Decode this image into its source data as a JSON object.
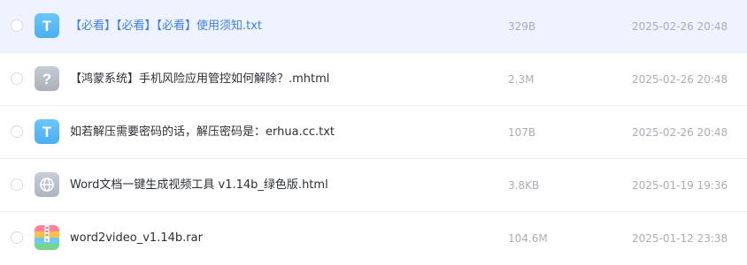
{
  "files": [
    {
      "name": "【必看】【必看】【必看】使用须知.txt",
      "size": "329B",
      "date": "2025-02-26 20:48",
      "icon": "text-file-icon",
      "selected": true
    },
    {
      "name": "【鸿蒙系统】手机风险应用管控如何解除？.mhtml",
      "size": "2.3M",
      "date": "2025-02-26 20:48",
      "icon": "unknown-file-icon",
      "selected": false
    },
    {
      "name": "如若解压需要密码的话，解压密码是：erhua.cc.txt",
      "size": "107B",
      "date": "2025-02-26 20:48",
      "icon": "text-file-icon",
      "selected": false
    },
    {
      "name": "Word文档一键生成视频工具 v1.14b_绿色版.html",
      "size": "3.8KB",
      "date": "2025-01-19 19:36",
      "icon": "web-file-icon",
      "selected": false
    },
    {
      "name": "word2video_v1.14b.rar",
      "size": "104.6M",
      "date": "2025-01-12 23:38",
      "icon": "archive-file-icon",
      "selected": false
    }
  ],
  "icon_glyphs": {
    "text": "T",
    "unknown": "?"
  },
  "colors": {
    "selected_row_bg": "#eef3ff",
    "selected_text": "#3f7ee8",
    "text_icon_bg": "#5ab9f5",
    "unknown_icon_bg": "#b7bdc8",
    "web_icon_bg": "#b9c0cc",
    "meta_text": "#a9adb4"
  }
}
